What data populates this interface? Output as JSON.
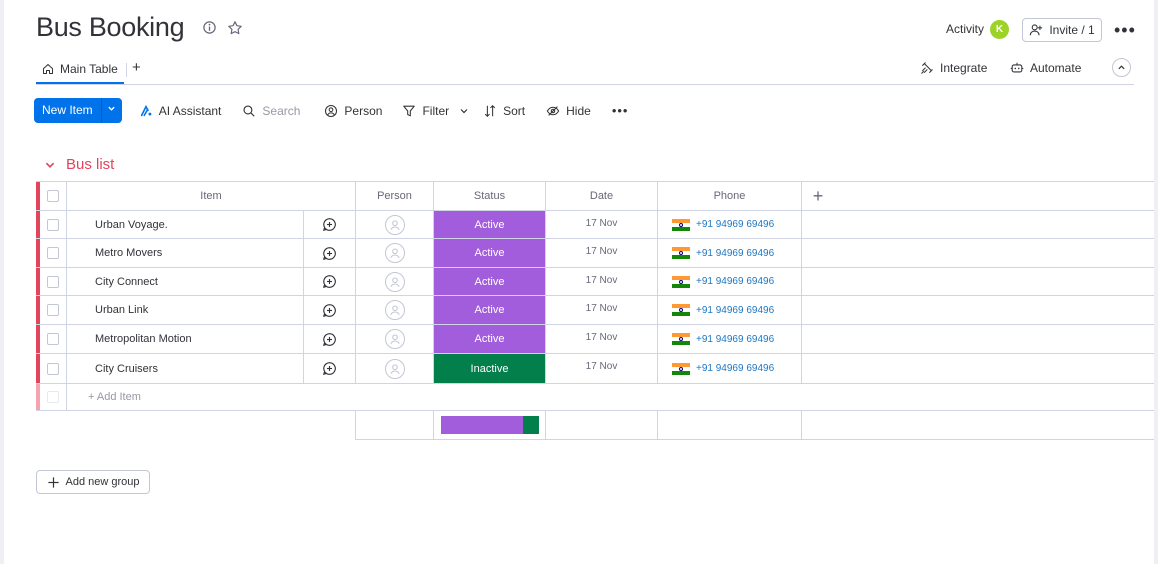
{
  "header": {
    "title": "Bus Booking",
    "activity_label": "Activity",
    "activity_avatar": "K",
    "invite_label": "Invite / 1"
  },
  "tabs": {
    "main_table": "Main Table",
    "add": "+",
    "integrate": "Integrate",
    "automate": "Automate"
  },
  "toolbar": {
    "new_item": "New Item",
    "ai_assistant": "AI Assistant",
    "search_placeholder": "Search",
    "person": "Person",
    "filter": "Filter",
    "sort": "Sort",
    "hide": "Hide"
  },
  "group": {
    "title": "Bus list",
    "color": "#e2445c",
    "columns": [
      "Item",
      "Person",
      "Status",
      "Date",
      "Phone"
    ],
    "add_item": "+ Add Item",
    "rows": [
      {
        "name": "Urban Voyage.",
        "status": "Active",
        "status_color": "#a25ddc",
        "date": "17 Nov",
        "phone": "+91 94969 69496"
      },
      {
        "name": "Metro Movers",
        "status": "Active",
        "status_color": "#a25ddc",
        "date": "17 Nov",
        "phone": "+91 94969 69496"
      },
      {
        "name": "City Connect",
        "status": "Active",
        "status_color": "#a25ddc",
        "date": "17 Nov",
        "phone": "+91 94969 69496"
      },
      {
        "name": "Urban Link",
        "status": "Active",
        "status_color": "#a25ddc",
        "date": "17 Nov",
        "phone": "+91 94969 69496"
      },
      {
        "name": "Metropolitan Motion",
        "status": "Active",
        "status_color": "#a25ddc",
        "date": "17 Nov",
        "phone": "+91 94969 69496"
      },
      {
        "name": "City Cruisers",
        "status": "Inactive",
        "status_color": "#037f4c",
        "date": "17 Nov",
        "phone": "+91 94969 69496"
      }
    ],
    "status_summary": [
      {
        "label": "Active",
        "fraction": 0.833,
        "color": "#a25ddc"
      },
      {
        "label": "Inactive",
        "fraction": 0.167,
        "color": "#037f4c"
      }
    ]
  },
  "add_group_label": "Add new group"
}
